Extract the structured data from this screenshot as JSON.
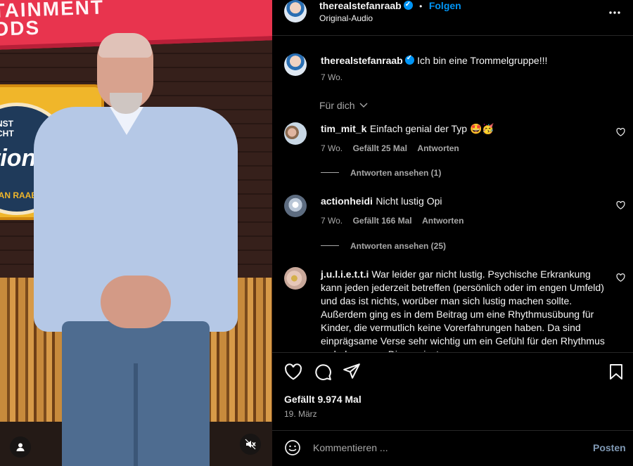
{
  "video": {
    "banner_text": "TAINMENT\nODS",
    "logo_top_text": "NST\nCHT",
    "logo_main_text": "tion",
    "logo_bottom_text": "FAN RAAB"
  },
  "header": {
    "username": "therealstefanraab",
    "separator": "•",
    "follow_label": "Folgen",
    "audio_label": "Original-Audio",
    "more_icon": "more-horizontal-icon"
  },
  "caption": {
    "username": "therealstefanraab",
    "text": "Ich bin eine Trommelgruppe!!!",
    "time": "7 Wo."
  },
  "sort": {
    "label": "Für dich"
  },
  "comments": [
    {
      "username": "tim_mit_k",
      "text": "Einfach genial der Typ 🤩🥳",
      "time": "7 Wo.",
      "likes": "Gefällt 25 Mal",
      "reply_label": "Antworten",
      "view_replies": "Antworten ansehen (1)"
    },
    {
      "username": "actionheidi",
      "text": "Nicht lustig Opi",
      "time": "7 Wo.",
      "likes": "Gefällt 166 Mal",
      "reply_label": "Antworten",
      "view_replies": "Antworten ansehen (25)"
    },
    {
      "username": "j.u.l.i.e.t.t.i",
      "text": "War leider gar nicht lustig. Psychische Erkrankung kann jeden jederzeit betreffen (persönlich oder im engen Umfeld) und das ist nichts, worüber man sich lustig machen sollte. Außerdem ging es in dem Beitrag um eine Rhythmusübung für Kinder, die vermutlich keine Vorerfahrungen haben. Da sind einprägsame Verse sehr wichtig um ein Gefühl für den Rhythmus zu bekommen. Die wenigsten"
    }
  ],
  "actions": {
    "likes": "Gefällt 9.974 Mal",
    "date": "19. März"
  },
  "composer": {
    "placeholder": "Kommentieren ...",
    "post_label": "Posten"
  },
  "colors": {
    "accent": "#0095f6",
    "post_disabled": "#7f98b3"
  }
}
